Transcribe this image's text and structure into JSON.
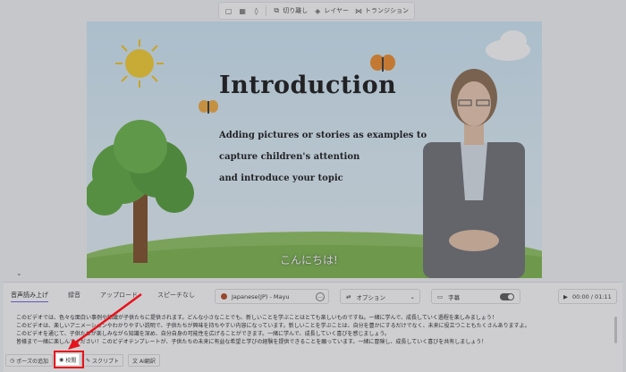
{
  "toolbar": {
    "trim_label": "切り離し",
    "layer_label": "レイヤー",
    "transition_label": "トランジション"
  },
  "slide": {
    "title": "Introduction",
    "line1": "Adding pictures or stories as examples to",
    "line2": "capture children's attention",
    "line3": "and introduce your topic",
    "subtitle": "こんにちは!"
  },
  "panel": {
    "tabs": [
      {
        "label": "音声読み上げ"
      },
      {
        "label": "録音"
      },
      {
        "label": "アップロード"
      },
      {
        "label": "スピーチなし"
      }
    ],
    "voice": "Japanese(JP) - Mayu",
    "voice_more": "…",
    "option_label": "オプション",
    "caption_label": "字幕",
    "time": "00:00 / 01:11",
    "script": [
      "このビデオでは、色々な面白い事例や知識が子供たちに提供されます。どんな小さなことでも、新しいことを学ぶことはとても楽しいものですね。一緒に学んで、成長していく過程を楽しみましょう！",
      "このビデオは、楽しいアニメーションやわかりやすい説明で、子供たちが興味を持ちやすい内容になっています。新しいことを学ぶことは、自分を豊かにするだけでなく、未来に役立つこともたくさんありますよ。",
      "このビデオを通じて、子供たちが楽しみながら知識を深め、自分自身の可能性を広げることができます。一緒に学んで、成長していく喜びを感じましょう。",
      "皆様まで一緒に楽しんでください！このビデオテンプレートが、子供たちの未来に有益な希望と学びの経験を提供できることを願っています。一緒に冒険し、成長していく喜びを共有しましょう！"
    ],
    "actions": [
      {
        "label": "ポーズの追加",
        "icon": "clock-icon"
      },
      {
        "label": "校閲",
        "icon": "eye-icon"
      },
      {
        "label": "スクリプト",
        "icon": "wand-icon"
      },
      {
        "label": "AI翻訳",
        "icon": "translate-icon"
      }
    ]
  },
  "colors": {
    "highlight": "#e8131b",
    "accent": "#6c5ce7"
  }
}
